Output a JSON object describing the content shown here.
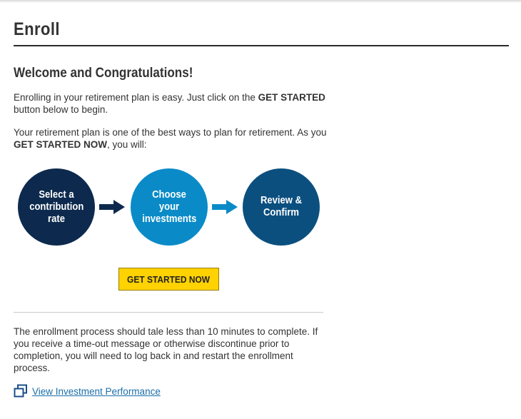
{
  "page": {
    "title": "Enroll",
    "welcome_heading": "Welcome and Congratulations!"
  },
  "intro": {
    "p1_a": "Enrolling in your retirement plan is easy. Just click on the ",
    "p1_b": "GET STARTED",
    "p1_c": " button below to begin.",
    "p2_a": "Your retirement plan is one of the best ways to plan for retirement. As you ",
    "p2_b": "GET STARTED NOW",
    "p2_c": ", you will:"
  },
  "steps": [
    {
      "label": "Select a contribution rate",
      "color": "#0d2a4e"
    },
    {
      "label": "Choose your investments",
      "color": "#0a8bc8"
    },
    {
      "label": "Review & Confirm",
      "color": "#0b4f7f"
    }
  ],
  "arrows": [
    {
      "color": "#0d2a4e"
    },
    {
      "color": "#0a8bc8"
    }
  ],
  "cta": {
    "label": "GET STARTED NOW",
    "color": "#ffd200"
  },
  "note": "The enrollment process should tale less than 10 minutes to complete. If you receive a time-out message or otherwise discontinue prior to completion, you will need to log back in and restart the enrollment process.",
  "link": {
    "label": "View Investment Performance",
    "icon": "new-window-icon",
    "color": "#1a6ea8"
  }
}
